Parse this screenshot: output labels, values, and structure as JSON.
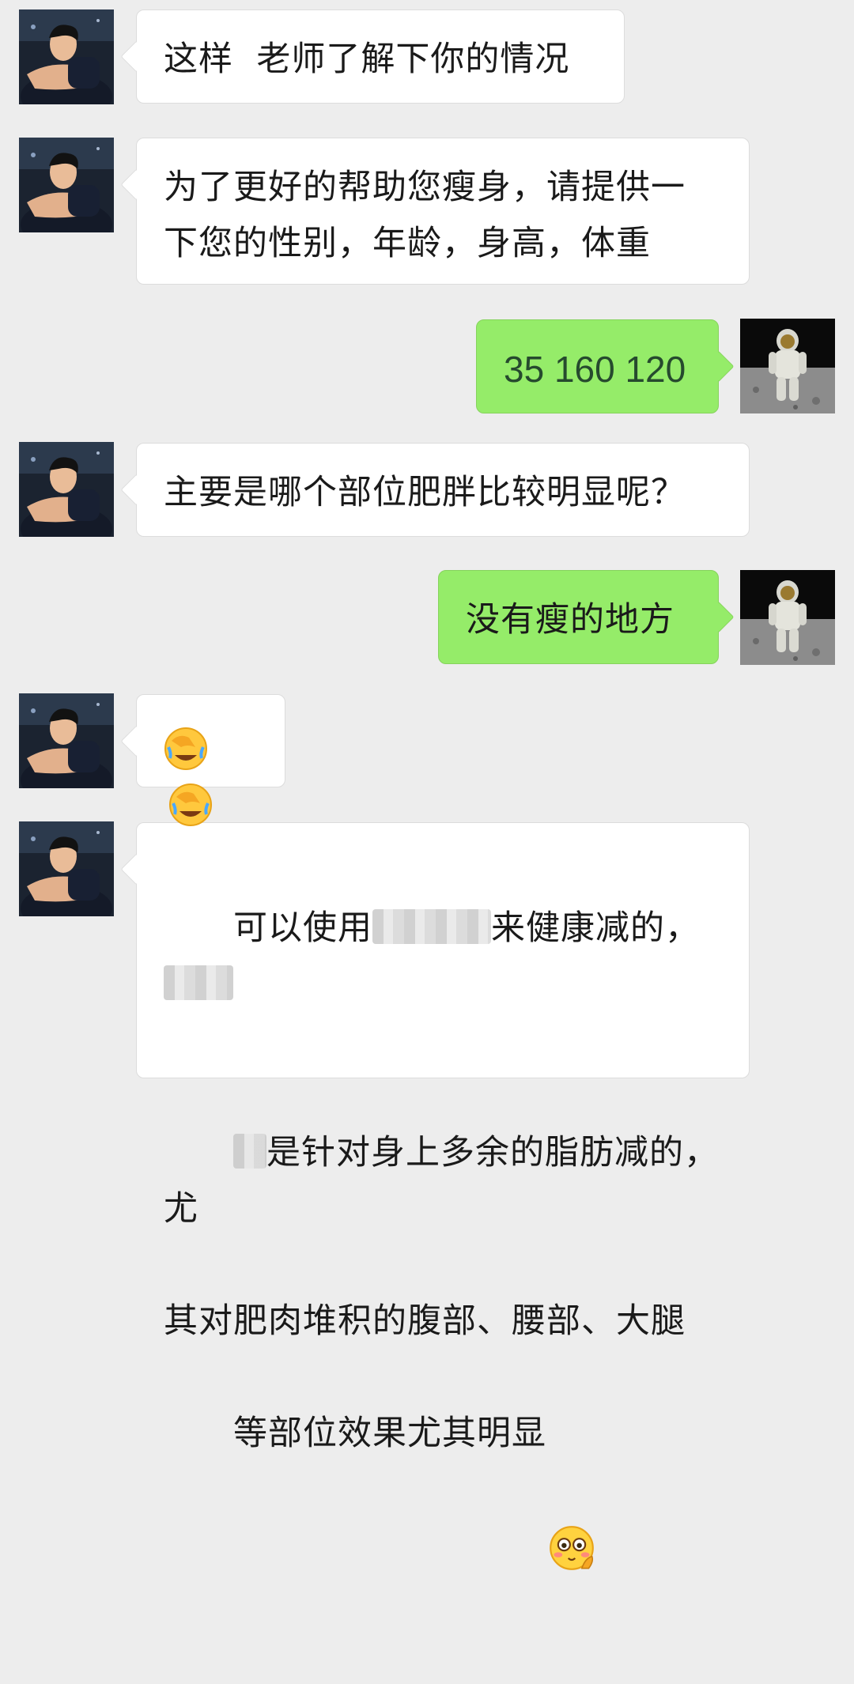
{
  "messages": [
    {
      "side": "in",
      "text": "这样  老师了解下你的情况"
    },
    {
      "side": "in",
      "line1": "为了更好的帮助您瘦身，请提供一",
      "line2": "下您的性别，年龄，身高，体重"
    },
    {
      "side": "out",
      "text": "35 160 120"
    },
    {
      "side": "in",
      "text": "主要是哪个部位肥胖比较明显呢？"
    },
    {
      "side": "out",
      "text": "没有瘦的地方"
    },
    {
      "side": "in",
      "emojis": [
        "facepalm-cry-emoji",
        "facepalm-cry-emoji"
      ]
    },
    {
      "side": "in",
      "line1_a": "可以使用",
      "line1_b": "来健康减的，",
      "line2_a": "是针对身上多余的脂肪减的，尤",
      "line3": "其对肥肉堆积的腹部、腰部、大腿",
      "line4": "等部位效果尤其明显",
      "trailing_emoji": "flushed-hand-emoji"
    }
  ],
  "avatars": {
    "teacher": "man-in-dark-shirt-avatar",
    "user": "astronaut-on-moon-avatar"
  },
  "colors": {
    "background": "#ededed",
    "incoming_bubble": "#ffffff",
    "outgoing_bubble": "#95ec69"
  }
}
